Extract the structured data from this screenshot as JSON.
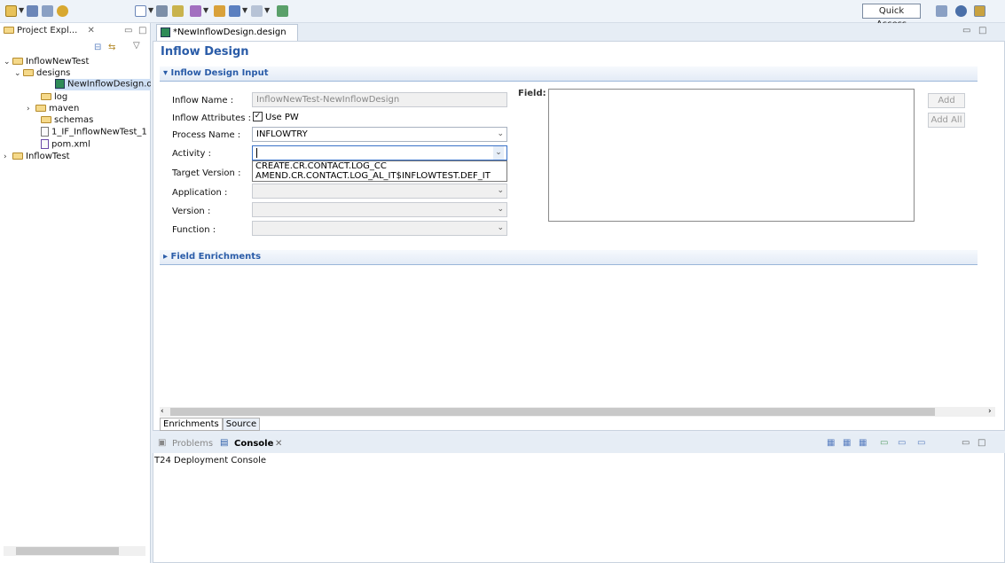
{
  "toolbar": {
    "quick_access": "Quick Access"
  },
  "project_explorer": {
    "tab_label": "Project Expl...",
    "tree": [
      {
        "label": "InflowNewTest",
        "type": "project",
        "expanded": true
      },
      {
        "label": "designs",
        "type": "folder",
        "expanded": true
      },
      {
        "label": "NewInflowDesign.design",
        "type": "design",
        "selected": true
      },
      {
        "label": "log",
        "type": "folder"
      },
      {
        "label": "maven",
        "type": "folder",
        "collapsed": true
      },
      {
        "label": "schemas",
        "type": "folder"
      },
      {
        "label": "1_IF_InflowNewTest_1",
        "type": "file"
      },
      {
        "label": "pom.xml",
        "type": "file"
      },
      {
        "label": "InflowTest",
        "type": "project",
        "collapsed": true
      }
    ]
  },
  "editor": {
    "tab_label": "*NewInflowDesign.design",
    "title": "Inflow Design",
    "section_input": "Inflow Design Input",
    "section_enrichments": "Field Enrichments",
    "fields": {
      "inflow_name_label": "Inflow Name :",
      "inflow_name_value": "InflowNewTest-NewInflowDesign",
      "inflow_attributes_label": "Inflow Attributes :",
      "use_pw_label": "Use PW",
      "process_name_label": "Process Name :",
      "process_name_value": "INFLOWTRY",
      "activity_label": "Activity :",
      "activity_value": "",
      "target_version_label": "Target Version :",
      "application_label": "Application :",
      "version_label": "Version :",
      "function_label": "Function :",
      "field_label": "Field:"
    },
    "activity_options": [
      "CREATE.CR.CONTACT.LOG_CC",
      "AMEND.CR.CONTACT.LOG_AL_IT$INFLOWTEST.DEF_IT"
    ],
    "buttons": {
      "add": "Add",
      "add_all": "Add All"
    },
    "bottom_tabs": {
      "enrichments": "Enrichments",
      "source": "Source"
    }
  },
  "console": {
    "problems_tab": "Problems",
    "console_tab": "Console",
    "text": "T24 Deployment Console"
  }
}
